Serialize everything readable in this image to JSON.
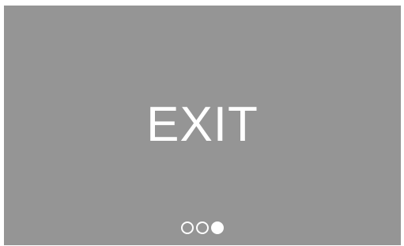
{
  "screen": {
    "title": "EXIT",
    "background_color": "#959595",
    "text_color": "#ffffff"
  },
  "pager": {
    "total_pages": 3,
    "current_page": 3
  }
}
